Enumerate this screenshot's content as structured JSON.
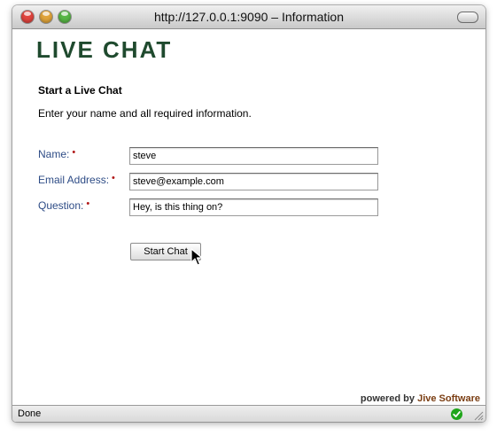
{
  "window": {
    "title": "http://127.0.0.1:9090 – Information"
  },
  "brand": {
    "text": "LIVE CHAT",
    "color": "#1f4a2e"
  },
  "form": {
    "section_title": "Start a Live Chat",
    "instructions": "Enter your name and all required information.",
    "required_marker": "•",
    "fields": [
      {
        "label": "Name:",
        "value": "steve"
      },
      {
        "label": "Email Address:",
        "value": "steve@example.com"
      },
      {
        "label": "Question:",
        "value": "Hey, is this thing on?"
      }
    ],
    "submit_label": "Start Chat"
  },
  "footer": {
    "powered_prefix": "powered by",
    "powered_brand": "Jive Software"
  },
  "statusbar": {
    "text": "Done",
    "status_icon": "check-circle-icon"
  },
  "colors": {
    "label": "#2e4c86",
    "required": "#b01818",
    "status_ok": "#1fa51a"
  }
}
